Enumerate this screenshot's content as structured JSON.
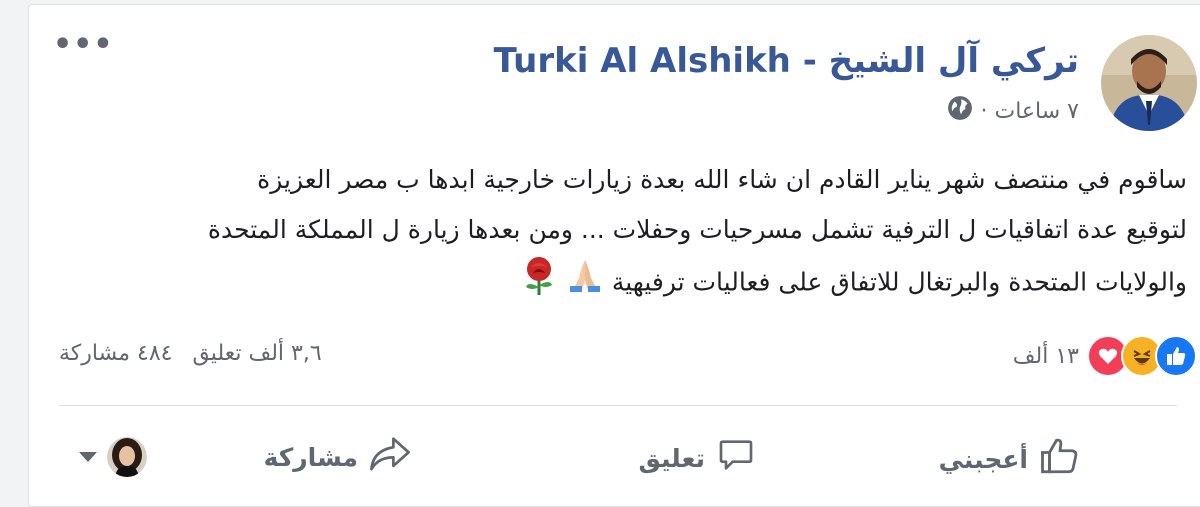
{
  "post": {
    "author": "تركي آل الشيخ - Turki Al Alshikh",
    "time": "٧ ساعات ·",
    "audience_icon": "globe-icon",
    "text_lines": [
      "ساقوم في منتصف شهر يناير القادم ان شاء الله بعدة زيارات خارجية ابدها ب مصر العزيزة",
      "لتوقيع عدة اتفاقيات ل الترفية تشمل مسرحيات وحفلات ... ومن بعدها زيارة ل المملكة المتحدة",
      "والولايات المتحدة والبرتغال للاتفاق على فعاليات ترفيهية"
    ],
    "emojis": [
      "folded-hands-emoji",
      "rose-emoji"
    ]
  },
  "reactions": {
    "types": [
      "like-reaction-icon",
      "haha-reaction-icon",
      "love-reaction-icon"
    ],
    "count": "١٣ ألف"
  },
  "stats": {
    "comments": "٣,٦ ألف تعليق",
    "shares": "٤٨٤ مشاركة"
  },
  "actions": {
    "like": "أعجبني",
    "comment": "تعليق",
    "share": "مشاركة"
  },
  "colors": {
    "author": "#385898",
    "like_blue": "#1877f2",
    "love_red": "#f33e58",
    "haha_yellow": "#f7b125"
  }
}
